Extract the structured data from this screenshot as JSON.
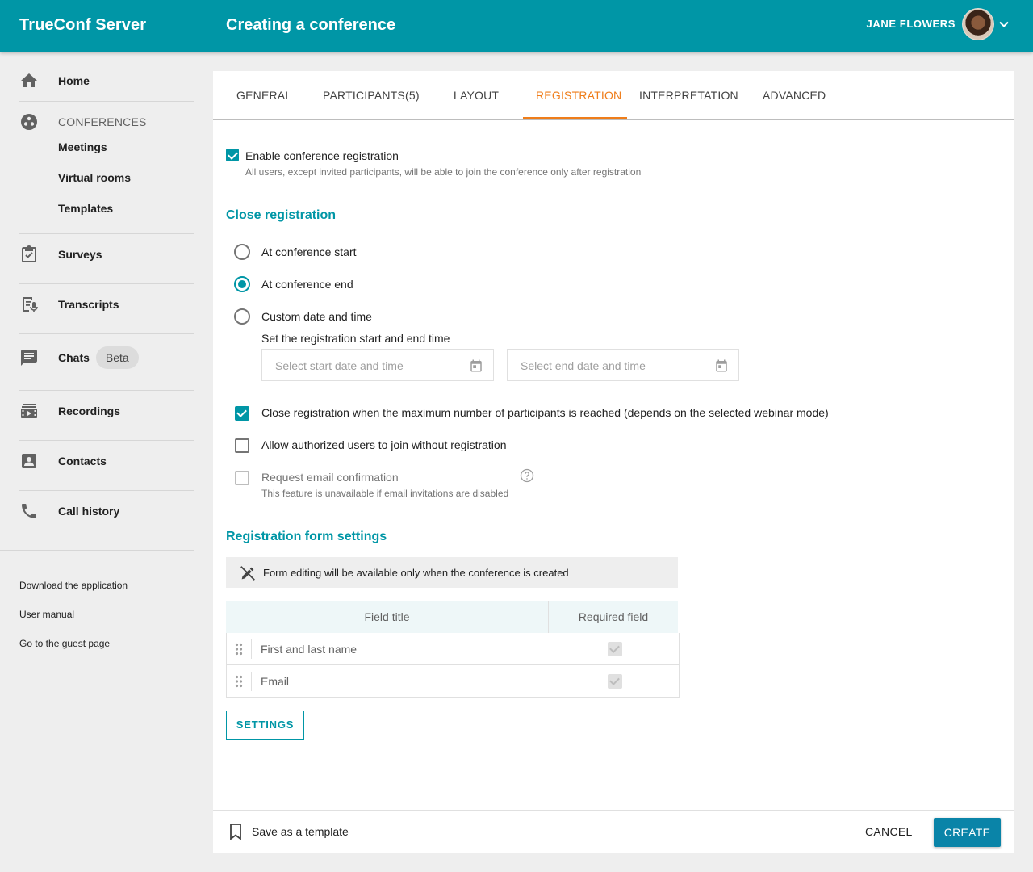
{
  "header": {
    "app_title": "TrueConf Server",
    "page_title": "Creating a conference",
    "user_name": "JANE FLOWERS"
  },
  "sidebar": {
    "home": "Home",
    "conferences_heading": "CONFERENCES",
    "meetings": "Meetings",
    "virtual_rooms": "Virtual rooms",
    "templates": "Templates",
    "surveys": "Surveys",
    "transcripts": "Transcripts",
    "chats": "Chats",
    "chats_badge": "Beta",
    "recordings": "Recordings",
    "contacts": "Contacts",
    "call_history": "Call history",
    "footer": {
      "download": "Download the application",
      "manual": "User manual",
      "guest": "Go to the guest page"
    }
  },
  "tabs": [
    {
      "label": "GENERAL",
      "active": false
    },
    {
      "label": "PARTICIPANTS(5)",
      "active": false
    },
    {
      "label": "LAYOUT",
      "active": false
    },
    {
      "label": "REGISTRATION",
      "active": true
    },
    {
      "label": "INTERPRETATION",
      "active": false
    },
    {
      "label": "ADVANCED",
      "active": false
    }
  ],
  "registration": {
    "enable_label": "Enable conference registration",
    "enable_checked": true,
    "enable_hint": "All users, except invited participants, will be able to join the conference only after registration",
    "close_title": "Close registration",
    "close_options": [
      {
        "label": "At conference start",
        "selected": false
      },
      {
        "label": "At conference end",
        "selected": true
      },
      {
        "label": "Custom date and time",
        "selected": false
      }
    ],
    "custom_hint": "Set the registration start and end time",
    "start_placeholder": "Select start date and time",
    "end_placeholder": "Select end date and time",
    "max_participants_label": "Close registration when the maximum number of participants is reached (depends on the selected webinar mode)",
    "max_participants_checked": true,
    "allow_auth_label": "Allow authorized users to join without registration",
    "allow_auth_checked": false,
    "email_confirm_label": "Request email confirmation",
    "email_confirm_checked": false,
    "email_confirm_hint": "This feature is unavailable if email invitations are disabled"
  },
  "form_settings": {
    "title": "Registration form settings",
    "notice": "Form editing will be available only when the conference is created",
    "columns": [
      "Field title",
      "Required field"
    ],
    "rows": [
      {
        "field": "First and last name",
        "required": true
      },
      {
        "field": "Email",
        "required": true
      }
    ],
    "settings_button": "SETTINGS"
  },
  "footer_bar": {
    "save_template": "Save as a template",
    "cancel": "CANCEL",
    "create": "CREATE"
  },
  "colors": {
    "accent": "#0096a6",
    "active_tab": "#ef7d1a",
    "create_button": "#0a84a8"
  }
}
